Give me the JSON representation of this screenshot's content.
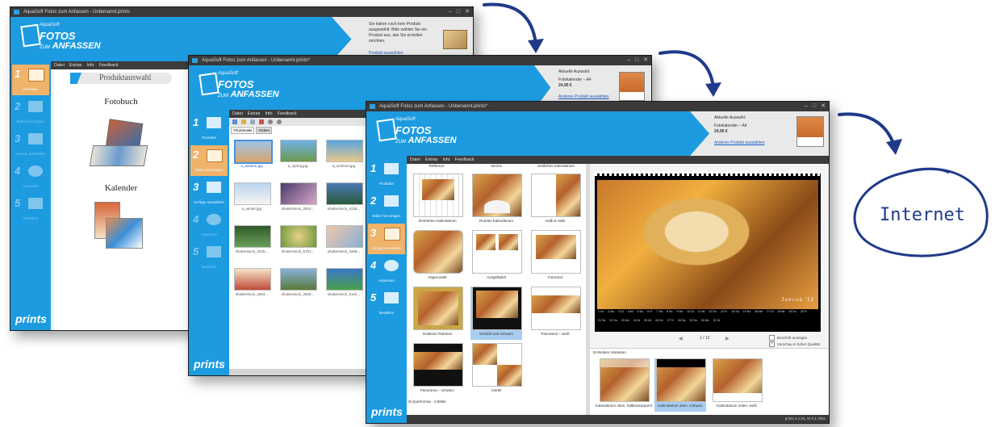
{
  "windows": {
    "w1": {
      "title": "AquaSoft Fotos zum Anfassen - Unbenannt.prints",
      "info_text": "Sie haben noch kein Produkt ausgewählt. Bitte wählen Sie ein Produkt aus, das Sie erstellen möchten.",
      "info_link": "Produkt auswählen",
      "section_heading": "Produktauswahl",
      "products": [
        "Fotobuch",
        "Kalender"
      ]
    },
    "w2": {
      "title": "AquaSoft Fotos zum Anfassen - Unbenannt.prints*",
      "tabs": [
        "Thumbnails",
        "Ordner"
      ],
      "images": [
        "a_autumn.jpg",
        "a_spring.jpg",
        "a_summer.jpg",
        "a_winter.jpg",
        "shutterstock_2814...",
        "shutterstock_4136...",
        "shutterstock_4225...",
        "shutterstock_5701...",
        "shutterstock_1608...",
        "shutterstock_2604...",
        "shutterstock_2635...",
        "shutterstock_2162..."
      ]
    },
    "w3": {
      "title": "AquaSoft Fotos zum Anfassen - Unbenannt.prints*",
      "layouts_top": [
        "Reflexion",
        "Herzen",
        "Seitliches Kalendarium"
      ],
      "layouts": [
        "Zentrierter Kalendarium",
        "Rundes Kalendarium",
        "Halb & Halb",
        "Abgerundet",
        "Ausgefädelt",
        "Fotorand",
        "Goldener Rahmen",
        "Schlicht und schwarz",
        "Panorama – weiß",
        "Panorama – schwarz",
        "Viertel"
      ],
      "section_label": "Querformat - 2 Bilder",
      "calendar_month": "Januar '12",
      "page_indicator": "1 / 12",
      "option_show_labels": "Beschrift anzeigen",
      "option_high_quality": "Vorschau in hoher Qualität",
      "variants_label": "Weitere Varianten",
      "variants": [
        "Kalendarium oben, halbtransparent",
        "Kalendarium oben, schwarz",
        "Kalendarium unten, weiß"
      ],
      "version": "prints 4.1.04, W 6.1.7601"
    }
  },
  "menu": [
    "Datei",
    "Extras",
    "Info",
    "Feedback"
  ],
  "brand": {
    "company": "AquaSoft",
    "logo_line1": "FOTOS",
    "logo_zum": "ZUM",
    "logo_line2": "ANFASSEN",
    "sidebar_logo": "prints"
  },
  "steps": [
    {
      "num": "1",
      "label": "Produkte"
    },
    {
      "num": "2",
      "label": "Bilder hinzufügen"
    },
    {
      "num": "3",
      "label": "Vorlage auswählen"
    },
    {
      "num": "4",
      "label": "Anpassen"
    },
    {
      "num": "5",
      "label": "Bestellen"
    }
  ],
  "selection": {
    "label": "Aktuelle Auswahl:",
    "product": "Fotokalender – A4",
    "price": "24,95 €",
    "change_link": "Anderes Produkt auswählen"
  },
  "internet_label": "Internet",
  "calendar_days": [
    "1 So",
    "2 Mo",
    "3 Di",
    "4 Mi",
    "5 Do",
    "6 Fr",
    "7 Sa",
    "8 So",
    "9 Mo",
    "10 Di",
    "11 Mi",
    "12 Do",
    "13 Fr",
    "14 Sa",
    "15 So",
    "16 Mo",
    "17 Di",
    "18 Mi",
    "19 Do",
    "20 Fr",
    "21 Sa",
    "22 So",
    "23 Mo",
    "24 Di",
    "25 Mi",
    "26 Do",
    "27 Fr",
    "28 Sa",
    "29 So",
    "30 Mo",
    "31 Di"
  ],
  "colors": {
    "brand_blue": "#1c9be0",
    "active_step": "#f0b36a",
    "selection_blue": "#a9cdf2",
    "arrow_navy": "#1f3a8a"
  }
}
